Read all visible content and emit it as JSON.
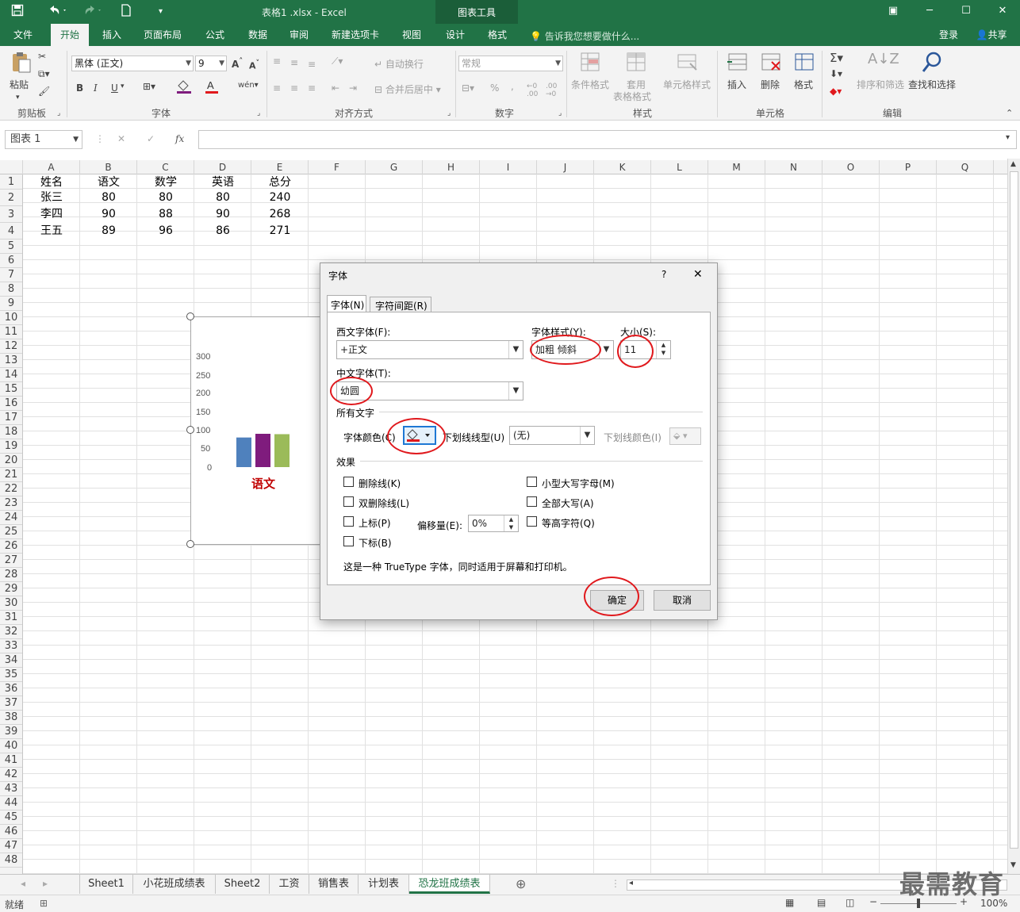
{
  "window": {
    "title": "表格1 .xlsx - Excel",
    "context_tools_title": "图表工具",
    "login": "登录",
    "share": "共享",
    "tell_me": "告诉我您想要做什么..."
  },
  "tabs": [
    {
      "label": "文件"
    },
    {
      "label": "开始"
    },
    {
      "label": "插入"
    },
    {
      "label": "页面布局"
    },
    {
      "label": "公式"
    },
    {
      "label": "数据"
    },
    {
      "label": "审阅"
    },
    {
      "label": "新建选项卡"
    },
    {
      "label": "视图"
    },
    {
      "label": "设计"
    },
    {
      "label": "格式"
    }
  ],
  "ribbon": {
    "clipboard": {
      "paste": "粘贴",
      "label": "剪贴板"
    },
    "font": {
      "name": "黑体 (正文)",
      "size": "9",
      "bold": "B",
      "italic": "I",
      "underline": "U",
      "label": "字体"
    },
    "alignment": {
      "wrap": "自动换行",
      "merge": "合并后居中",
      "label": "对齐方式"
    },
    "number": {
      "format": "常规",
      "percent": "%",
      "comma": ",",
      "label": "数字"
    },
    "styles": {
      "cond": "条件格式",
      "table_1": "套用",
      "table_2": "表格格式",
      "cell": "单元格样式",
      "label": "样式"
    },
    "cells": {
      "insert": "插入",
      "delete": "删除",
      "format": "格式",
      "label": "单元格"
    },
    "editing": {
      "sort": "排序和筛选",
      "find": "查找和选择",
      "label": "编辑"
    }
  },
  "formula_bar": {
    "name_box": "图表 1",
    "fx": "fx"
  },
  "columns": [
    "A",
    "B",
    "C",
    "D",
    "E",
    "F",
    "G",
    "H",
    "I",
    "J",
    "K",
    "L",
    "M",
    "N",
    "O",
    "P",
    "Q"
  ],
  "rows": [
    "1",
    "2",
    "3",
    "4",
    "5",
    "6",
    "7",
    "8",
    "9",
    "10",
    "11",
    "12",
    "13",
    "14",
    "15",
    "16",
    "17",
    "18",
    "19",
    "20",
    "21",
    "22",
    "23",
    "24",
    "25",
    "26",
    "27",
    "28",
    "29",
    "30",
    "31",
    "32",
    "33",
    "34",
    "35",
    "36",
    "37",
    "38",
    "39",
    "40",
    "41",
    "42",
    "43",
    "44",
    "45",
    "46",
    "47",
    "48"
  ],
  "table": {
    "headers": [
      "姓名",
      "语文",
      "数学",
      "英语",
      "总分"
    ],
    "rows": [
      [
        "张三",
        "80",
        "80",
        "80",
        "240"
      ],
      [
        "李四",
        "90",
        "88",
        "90",
        "268"
      ],
      [
        "王五",
        "89",
        "96",
        "86",
        "271"
      ]
    ]
  },
  "chart": {
    "y_ticks": [
      "300",
      "250",
      "200",
      "150",
      "100",
      "50",
      "0"
    ],
    "category_label": "语文",
    "ymax": 300,
    "values": [
      80,
      90,
      89
    ],
    "colors": [
      "#4f81bd",
      "#7f1c7d",
      "#9bbb59"
    ],
    "label_color": "#c00000"
  },
  "dialog": {
    "title": "字体",
    "help": "?",
    "close": "✕",
    "tab_font": "字体(N)",
    "tab_spacing": "字符间距(R)",
    "latin_font_label": "西文字体(F):",
    "latin_font_value": "+正文",
    "style_label": "字体样式(Y):",
    "style_value": "加粗 倾斜",
    "size_label": "大小(S):",
    "size_value": "11",
    "asian_font_label": "中文字体(T):",
    "asian_font_value": "幼圆",
    "all_text_label": "所有文字",
    "font_color_label": "字体颜色(C)",
    "underline_type_label": "下划线线型(U)",
    "underline_type_value": "(无)",
    "underline_color_label": "下划线颜色(I)",
    "effects_label": "效果",
    "effects": {
      "strikethrough": "删除线(K)",
      "double_strike": "双删除线(L)",
      "superscript": "上标(P)",
      "subscript": "下标(B)",
      "small_caps": "小型大写字母(M)",
      "all_caps": "全部大写(A)",
      "equalize": "等高字符(Q)"
    },
    "offset_label": "偏移量(E):",
    "offset_value": "0%",
    "description": "这是一种 TrueType 字体，同时适用于屏幕和打印机。",
    "ok": "确定",
    "cancel": "取消"
  },
  "sheets": [
    "Sheet1",
    "小花班成绩表",
    "Sheet2",
    "工资",
    "销售表",
    "计划表",
    "恐龙班成绩表"
  ],
  "status": {
    "ready": "就绪",
    "zoom": "100%"
  },
  "watermark": "最需教育"
}
